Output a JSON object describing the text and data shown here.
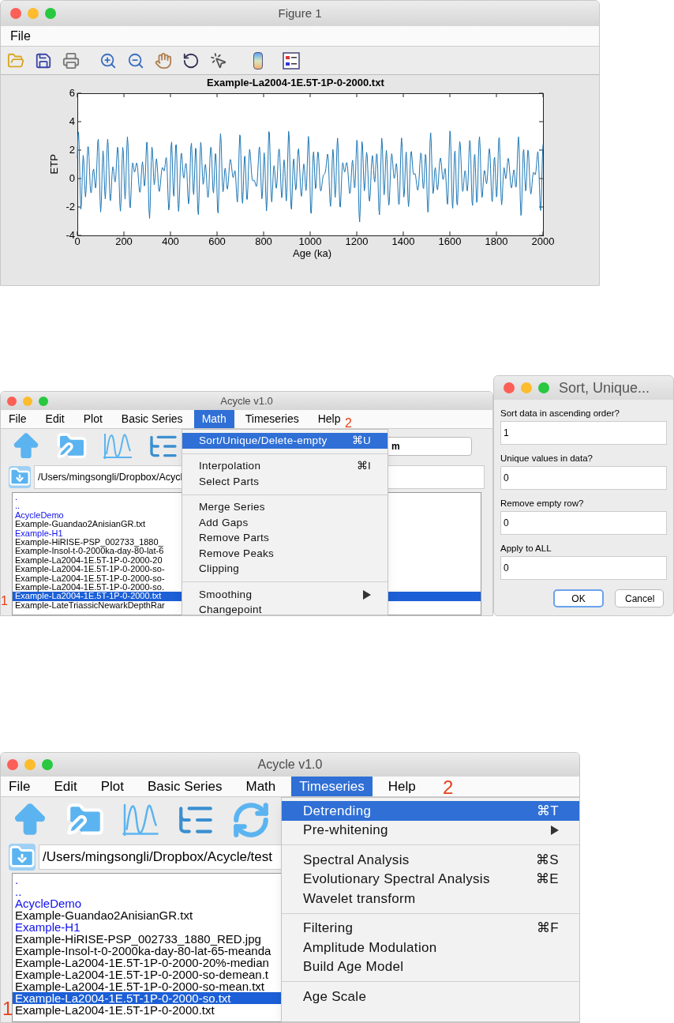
{
  "figure_window": {
    "title": "Figure 1",
    "menus": [
      "File"
    ],
    "plot": {
      "title": "Example-La2004-1E.5T-1P-0-2000.txt",
      "xlabel": "Age (ka)",
      "ylabel": "ETP",
      "xticks": [
        "0",
        "200",
        "400",
        "600",
        "800",
        "1000",
        "1200",
        "1400",
        "1600",
        "1800",
        "2000"
      ],
      "yticks": [
        "6",
        "4",
        "2",
        "0",
        "-2",
        "-4"
      ]
    }
  },
  "acycle_window_math": {
    "title": "Acycle v1.0",
    "menus": [
      {
        "label": "File",
        "selected": false
      },
      {
        "label": "Edit",
        "selected": false
      },
      {
        "label": "Plot",
        "selected": false
      },
      {
        "label": "Basic Series",
        "selected": false
      },
      {
        "label": "Math",
        "selected": true
      },
      {
        "label": "Timeseries",
        "selected": false
      },
      {
        "label": "Help",
        "selected": false
      }
    ],
    "unit_field": "m",
    "path": "/Users/mingsongli/Dropbox/Acycl",
    "files": [
      {
        "name": ".",
        "kind": "folder",
        "selected": false
      },
      {
        "name": "..",
        "kind": "folder",
        "selected": false
      },
      {
        "name": "AcycleDemo",
        "kind": "folder",
        "selected": false
      },
      {
        "name": "Example-Guandao2AnisianGR.txt",
        "kind": "file",
        "selected": false
      },
      {
        "name": "Example-H1",
        "kind": "folder",
        "selected": false
      },
      {
        "name": "Example-HiRISE-PSP_002733_1880_",
        "kind": "file",
        "selected": false
      },
      {
        "name": "Example-Insol-t-0-2000ka-day-80-lat-6",
        "kind": "file",
        "selected": false
      },
      {
        "name": "Example-La2004-1E.5T-1P-0-2000-20",
        "kind": "file",
        "selected": false
      },
      {
        "name": "Example-La2004-1E.5T-1P-0-2000-so-",
        "kind": "file",
        "selected": false
      },
      {
        "name": "Example-La2004-1E.5T-1P-0-2000-so-",
        "kind": "file",
        "selected": false
      },
      {
        "name": "Example-La2004-1E.5T-1P-0-2000-so.",
        "kind": "file",
        "selected": false
      },
      {
        "name": "Example-La2004-1E.5T-1P-0-2000.txt",
        "kind": "file",
        "selected": true
      },
      {
        "name": "Example-LateTriassicNewarkDepthRar",
        "kind": "file",
        "selected": false
      }
    ],
    "open_menu": [
      [
        {
          "label": "Sort/Unique/Delete-empty",
          "shortcut": "⌘U",
          "selected": true
        }
      ],
      [
        {
          "label": "Interpolation",
          "shortcut": "⌘I",
          "selected": false
        },
        {
          "label": "Select Parts",
          "selected": false
        }
      ],
      [
        {
          "label": "Merge Series",
          "selected": false
        },
        {
          "label": "Add Gaps",
          "selected": false
        },
        {
          "label": "Remove Parts",
          "selected": false
        },
        {
          "label": "Remove Peaks",
          "selected": false
        },
        {
          "label": "Clipping",
          "selected": false
        }
      ],
      [
        {
          "label": "Smoothing",
          "submenu": true,
          "selected": false
        },
        {
          "label": "Changepoint",
          "selected": false
        }
      ]
    ],
    "annotations": [
      "1",
      "2"
    ]
  },
  "dialog": {
    "title": "Sort, Unique...",
    "fields": [
      {
        "label": "Sort data in ascending order?",
        "value": "1"
      },
      {
        "label": "Unique values in data?",
        "value": "0"
      },
      {
        "label": "Remove empty row?",
        "value": "0"
      },
      {
        "label": "Apply to ALL",
        "value": "0"
      }
    ],
    "buttons": [
      {
        "label": "OK",
        "default": true
      },
      {
        "label": "Cancel",
        "default": false
      }
    ]
  },
  "acycle_window_timeseries": {
    "title": "Acycle v1.0",
    "menus": [
      {
        "label": "File",
        "selected": false
      },
      {
        "label": "Edit",
        "selected": false
      },
      {
        "label": "Plot",
        "selected": false
      },
      {
        "label": "Basic Series",
        "selected": false
      },
      {
        "label": "Math",
        "selected": false
      },
      {
        "label": "Timeseries",
        "selected": true
      },
      {
        "label": "Help",
        "selected": false
      }
    ],
    "path": "/Users/mingsongli/Dropbox/Acycle/test",
    "files": [
      {
        "name": ".",
        "kind": "folder",
        "selected": false
      },
      {
        "name": "..",
        "kind": "folder",
        "selected": false
      },
      {
        "name": "AcycleDemo",
        "kind": "folder",
        "selected": false
      },
      {
        "name": "Example-Guandao2AnisianGR.txt",
        "kind": "file",
        "selected": false
      },
      {
        "name": "Example-H1",
        "kind": "folder",
        "selected": false
      },
      {
        "name": "Example-HiRISE-PSP_002733_1880_RED.jpg",
        "kind": "file",
        "selected": false
      },
      {
        "name": "Example-Insol-t-0-2000ka-day-80-lat-65-meanda",
        "kind": "file",
        "selected": false
      },
      {
        "name": "Example-La2004-1E.5T-1P-0-2000-20%-median",
        "kind": "file",
        "selected": false
      },
      {
        "name": "Example-La2004-1E.5T-1P-0-2000-so-demean.t",
        "kind": "file",
        "selected": false
      },
      {
        "name": "Example-La2004-1E.5T-1P-0-2000-so-mean.txt",
        "kind": "file",
        "selected": false
      },
      {
        "name": "Example-La2004-1E.5T-1P-0-2000-so.txt",
        "kind": "file",
        "selected": true
      },
      {
        "name": "Example-La2004-1E.5T-1P-0-2000.txt",
        "kind": "file",
        "selected": false
      }
    ],
    "open_menu": [
      [
        {
          "label": "Detrending",
          "shortcut": "⌘T",
          "selected": true
        },
        {
          "label": "Pre-whitening",
          "submenu": true,
          "selected": false
        }
      ],
      [
        {
          "label": "Spectral Analysis",
          "shortcut": "⌘S",
          "selected": false
        },
        {
          "label": "Evolutionary Spectral Analysis",
          "shortcut": "⌘E",
          "selected": false
        },
        {
          "label": "Wavelet transform",
          "selected": false
        }
      ],
      [
        {
          "label": "Filtering",
          "shortcut": "⌘F",
          "selected": false
        },
        {
          "label": "Amplitude Modulation",
          "selected": false
        },
        {
          "label": "Build Age Model",
          "selected": false
        }
      ],
      [
        {
          "label": "Age Scale",
          "selected": false
        }
      ]
    ],
    "annotations": [
      "1",
      "2"
    ]
  }
}
